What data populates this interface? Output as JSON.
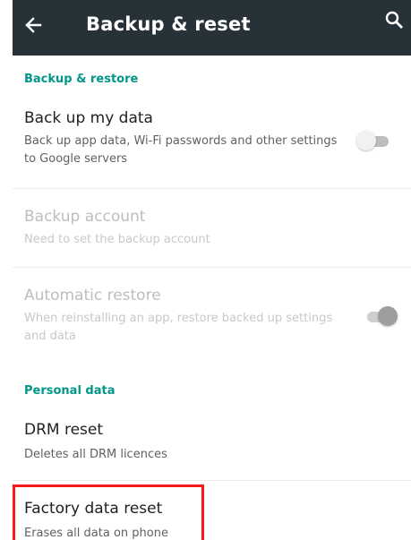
{
  "app_bar": {
    "title": "Backup & reset",
    "back_icon": "arrow-left-icon",
    "search_icon": "search-icon",
    "background": "#263238"
  },
  "sections": {
    "backup_restore": {
      "header": "Backup & restore",
      "back_up_my_data": {
        "title": "Back up my data",
        "summary": "Back up app data, Wi-Fi passwords and other settings to Google servers",
        "toggle_state": "off"
      },
      "backup_account": {
        "title": "Backup account",
        "summary": "Need to set the backup account"
      },
      "automatic_restore": {
        "title": "Automatic restore",
        "summary": "When reinstalling an app, restore backed up settings and data",
        "toggle_state": "on"
      }
    },
    "personal_data": {
      "header": "Personal data",
      "drm_reset": {
        "title": "DRM reset",
        "summary": "Deletes all DRM licences"
      },
      "factory_data_reset": {
        "title": "Factory data reset",
        "summary": "Erases all data on phone"
      }
    }
  },
  "colors": {
    "accent": "#009688",
    "highlight": "#ff1a1a"
  }
}
